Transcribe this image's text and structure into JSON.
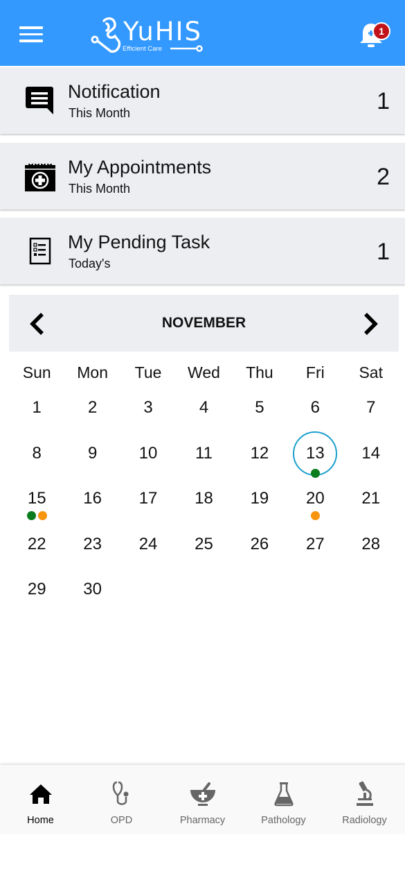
{
  "header": {
    "app_name": "YuHIS",
    "tagline": "Efficient Care",
    "notification_badge": "1",
    "brand_color": "#3399ff",
    "badge_color": "#c0141a",
    "icons": {
      "menu": "hamburger-menu-icon",
      "logo": "stethoscope-logo-icon",
      "bell": "notification-bell-icon"
    }
  },
  "summary_cards": [
    {
      "title": "Notification",
      "subtitle": "This Month",
      "count": "1",
      "icon": "message-icon"
    },
    {
      "title": "My Appointments",
      "subtitle": "This Month",
      "count": "2",
      "icon": "calendar-plus-icon"
    },
    {
      "title": "My Pending Task",
      "subtitle": "Today's",
      "count": "1",
      "icon": "checklist-icon"
    }
  ],
  "calendar": {
    "month": "NOVEMBER",
    "prev_icon": "chevron-left-icon",
    "next_icon": "chevron-right-icon",
    "weekdays": [
      "Sun",
      "Mon",
      "Tue",
      "Wed",
      "Thu",
      "Fri",
      "Sat"
    ],
    "first_weekday_index": 0,
    "days_in_month": 30,
    "selected_day": 13,
    "selected_ring_color": "#1a9fcc",
    "event_colors": {
      "green": "#0a7d1e",
      "orange": "#f7950f"
    },
    "events": {
      "13": [
        "green"
      ],
      "15": [
        "green",
        "orange"
      ],
      "20": [
        "orange"
      ]
    }
  },
  "bottom_nav": {
    "items": [
      {
        "label": "Home",
        "icon": "home-icon",
        "active": true
      },
      {
        "label": "OPD",
        "icon": "stethoscope-icon",
        "active": false
      },
      {
        "label": "Pharmacy",
        "icon": "mortar-pestle-icon",
        "active": false
      },
      {
        "label": "Pathology",
        "icon": "flask-icon",
        "active": false
      },
      {
        "label": "Radiology",
        "icon": "microscope-icon",
        "active": false
      }
    ]
  }
}
